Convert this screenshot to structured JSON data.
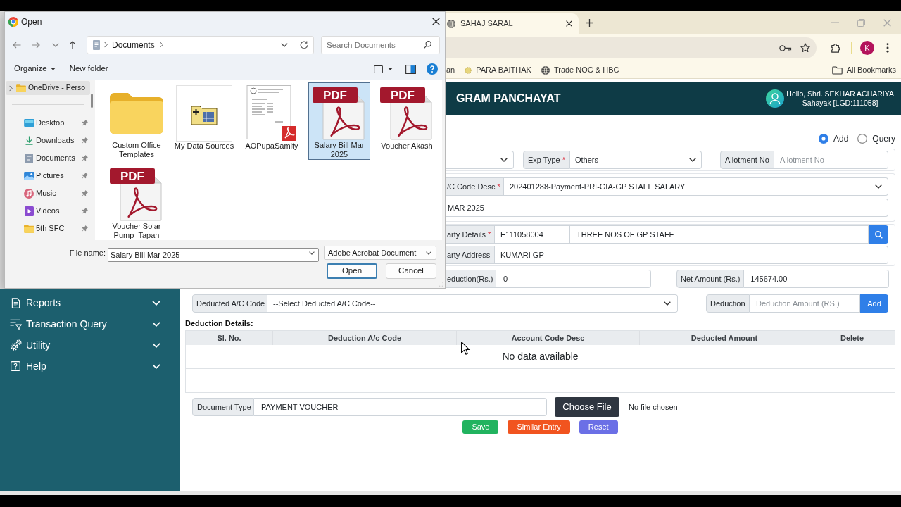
{
  "dialog": {
    "title": "Open",
    "location": "Documents",
    "search": {
      "placeholder": "Search Documents"
    },
    "commands": [
      {
        "label": "Organize",
        "kind": "menu"
      },
      {
        "label": "New folder",
        "kind": "button"
      }
    ],
    "tree": [
      {
        "label": "OneDrive - Perso",
        "selected": true,
        "expanded": false
      }
    ],
    "quick_access": [
      {
        "label": "Desktop",
        "kind": "desktop",
        "selected": false,
        "pinned": true
      },
      {
        "label": "Downloads",
        "kind": "downloads",
        "selected": false,
        "pinned": true
      },
      {
        "label": "Documents",
        "kind": "documents",
        "selected": false,
        "pinned": true
      },
      {
        "label": "Pictures",
        "kind": "pictures",
        "selected": false,
        "pinned": true
      },
      {
        "label": "Music",
        "kind": "music",
        "selected": false,
        "pinned": true
      },
      {
        "label": "Videos",
        "kind": "videos",
        "selected": false,
        "pinned": true
      },
      {
        "label": "5th SFC",
        "kind": "folder",
        "selected": false,
        "pinned": true
      }
    ],
    "files": [
      {
        "name": "Custom Office Templates",
        "kind": "folder",
        "selected": false
      },
      {
        "name": "My Data Sources",
        "kind": "datasource",
        "selected": false
      },
      {
        "name": "AOPupaSamity",
        "kind": "document",
        "selected": false
      },
      {
        "name": "Salary Bill Mar 2025",
        "kind": "pdf",
        "badge": "PDF",
        "selected": true
      },
      {
        "name": "Voucher Akash",
        "kind": "pdf",
        "badge": "PDF",
        "selected": false
      },
      {
        "name": "Voucher Solar Pump_Tapan",
        "kind": "pdf",
        "badge": "PDF",
        "selected": false
      }
    ],
    "file_name": {
      "label": "File name:",
      "value": "Salary Bill Mar 2025"
    },
    "file_type": {
      "value": "Adobe Acrobat Document"
    },
    "buttons": [
      {
        "label": "Open",
        "default": true
      },
      {
        "label": "Cancel",
        "default": false
      }
    ]
  },
  "browser": {
    "tabs": [
      {
        "title": "SAHAJ SARAL",
        "selected": true
      }
    ],
    "profile": "K",
    "bookmarks": [
      {
        "label": "an",
        "kind": "plain"
      },
      {
        "label": "PARA BAITHAK",
        "kind": "site"
      },
      {
        "label": "Trade NOC & HBC",
        "kind": "globe"
      }
    ],
    "all_bookmarks": "All Bookmarks"
  },
  "app": {
    "header": {
      "title": "GRAM PANCHAYAT",
      "greeting": "Hello, Shri. SEKHAR ACHARIYA",
      "role": "Sahayak [LGD:111058]"
    },
    "sidebar": [
      {
        "label": "Reports",
        "kind": "reports",
        "expanded": false
      },
      {
        "label": "Transaction Query",
        "kind": "query",
        "expanded": false
      },
      {
        "label": "Utility",
        "kind": "utility",
        "expanded": false
      },
      {
        "label": "Help",
        "kind": "help",
        "expanded": false
      }
    ],
    "mode": [
      {
        "label": "Add",
        "selected": true
      },
      {
        "label": "Query",
        "selected": false
      }
    ],
    "form": {
      "exp_type": {
        "label": "Exp Type",
        "required_mark": "*",
        "value": "Others"
      },
      "allotment_no": {
        "label": "Allotment No",
        "placeholder": "Allotment No"
      },
      "ac_code_desc": {
        "label": "/C Code Desc",
        "required_mark": "*",
        "value": "202401288-Payment-PRI-GIA-GP STAFF SALARY"
      },
      "text_field": {
        "value": "MAR 2025"
      },
      "party_details": {
        "label": "arty Details",
        "required_mark": "*",
        "code": "E111058004",
        "name": "THREE NOS OF GP STAFF"
      },
      "party_address": {
        "label": "arty Address",
        "value": "KUMARI GP"
      },
      "deduction_total": {
        "label": "eduction(Rs.)",
        "value": "0"
      },
      "net_amount": {
        "label": "Net Amount (Rs.)",
        "value": "145674.00"
      },
      "deducted_ac_code": {
        "label": "Deducted A/C Code",
        "value": "--Select Deducted A/C Code--"
      },
      "deduction": {
        "label": "Deduction",
        "placeholder": "Deduction Amount (RS.)",
        "button": "Add"
      }
    },
    "deduction_details": {
      "title": "Deduction Details:",
      "columns": [
        "Sl. No.",
        "Deduction A/c Code",
        "Account Code Desc",
        "Deducted Amount",
        "Delete"
      ],
      "empty_text": "No data available"
    },
    "document": {
      "label": "Document Type",
      "value": "PAYMENT VOUCHER",
      "button": "Choose File",
      "status": "No file chosen"
    },
    "actions": [
      {
        "label": "Save",
        "color": "#21b35f"
      },
      {
        "label": "Similar Entry",
        "color": "#f1541f"
      },
      {
        "label": "Reset",
        "color": "#6b6fe6"
      }
    ]
  }
}
